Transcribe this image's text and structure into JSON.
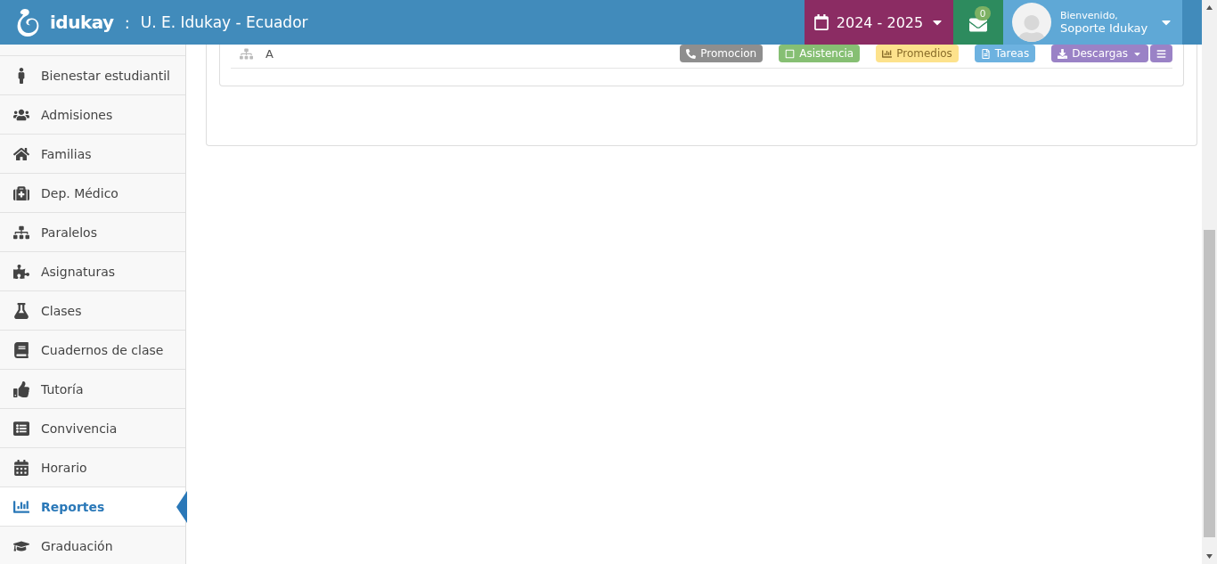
{
  "header": {
    "logo": "idukay",
    "separator": ":",
    "school": "U. E. Idukay - Ecuador",
    "year": "2024 - 2025",
    "messages": "0",
    "greeting": "Bienvenido,",
    "user": "Soporte Idukay"
  },
  "sidebar": {
    "items": [
      {
        "label": "Bienestar estudiantil",
        "selected": false
      },
      {
        "label": "Admisiones",
        "selected": false
      },
      {
        "label": "Familias",
        "selected": false
      },
      {
        "label": "Dep. Médico",
        "selected": false
      },
      {
        "label": "Paralelos",
        "selected": false
      },
      {
        "label": "Asignaturas",
        "selected": false
      },
      {
        "label": "Clases",
        "selected": false
      },
      {
        "label": "Cuadernos de clase",
        "selected": false
      },
      {
        "label": "Tutoría",
        "selected": false
      },
      {
        "label": "Convivencia",
        "selected": false
      },
      {
        "label": "Horario",
        "selected": false
      },
      {
        "label": "Reportes",
        "selected": true
      },
      {
        "label": "Graduación",
        "selected": false
      }
    ]
  },
  "row": {
    "label": "A",
    "actions": [
      {
        "label": "Promocion",
        "color": "#8e8e8e"
      },
      {
        "label": "Asistencia",
        "color": "#86bf73"
      },
      {
        "label": "Promedios",
        "color": "#fde28c"
      },
      {
        "label": "Tareas",
        "color": "#6db2e0"
      },
      {
        "label": "Descargas",
        "color": "#9a82c6",
        "dropdown": true
      },
      {
        "color": "#9a82c6",
        "kind": "menu"
      }
    ]
  }
}
